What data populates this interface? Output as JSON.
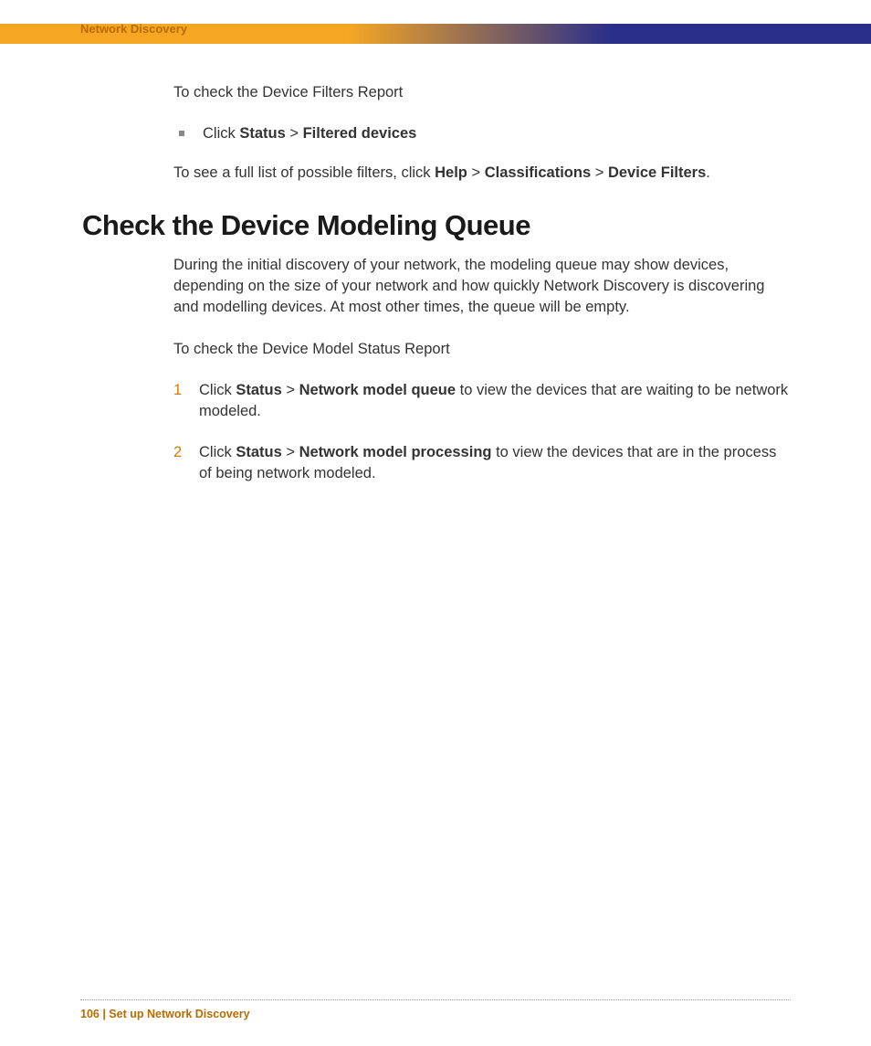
{
  "header": {
    "title": "Network Discovery"
  },
  "section1": {
    "para1": "To check the Device Filters Report",
    "bullet1_pre": "Click ",
    "bullet1_b1": "Status",
    "bullet1_mid": " > ",
    "bullet1_b2": "Filtered devices",
    "para2_pre": "To see a full list of possible filters, click ",
    "para2_b1": "Help",
    "para2_mid1": " > ",
    "para2_b2": "Classifications",
    "para2_mid2": " > ",
    "para2_b3": "Device Filters",
    "para2_end": "."
  },
  "section2": {
    "heading": "Check the Device Modeling Queue",
    "para1": "During the initial discovery of your network, the modeling queue may show devices, depending on the size of your network and how quickly Network Discovery is discovering and modelling devices. At most other times, the queue will be empty.",
    "para2": "To check the Device Model Status Report",
    "step1_num": "1",
    "step1_pre": "Click ",
    "step1_b1": "Status",
    "step1_mid": " > ",
    "step1_b2": "Network model queue",
    "step1_post": " to view the devices that are waiting to be network modeled.",
    "step2_num": "2",
    "step2_pre": "Click ",
    "step2_b1": "Status",
    "step2_mid": " > ",
    "step2_b2": "Network model processing",
    "step2_post": " to view the devices that are in the process of being network modeled."
  },
  "footer": {
    "text": "106 | Set up Network Discovery"
  }
}
